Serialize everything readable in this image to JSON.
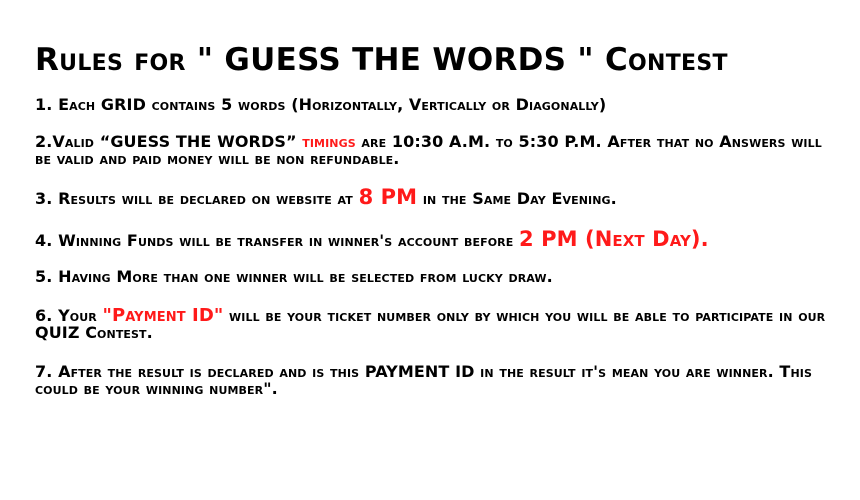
{
  "title": "Rules for \" GUESS THE WORDS \" Contest",
  "accent_color": "#ff1a1a",
  "rules": [
    {
      "text": "1. Each GRID contains 5 words (Horizontally, Vertically or Diagonally)"
    },
    {
      "before": "2.Valid “GUESS THE WORDS” ",
      "highlight": "timings",
      "after": " are 10:30 A.M. to 5:30 P.M. After that no Answers will be valid and paid money will be non refundable."
    },
    {
      "before": "3. Results will be declared on website at ",
      "highlight": "8 PM",
      "after": " in the Same Day Evening."
    },
    {
      "before": "4. Winning Funds will be transfer in winner's account before ",
      "highlight": "2 PM (Next Day).",
      "after": ""
    },
    {
      "text": "5. Having More than one winner will be selected from lucky draw."
    },
    {
      "before": "6. Your ",
      "highlight": "\"Payment ID\"",
      "after": " will be your ticket number only by which you will be able to participate in our QUIZ Contest."
    },
    {
      "text": "7. After the result is declared and is this PAYMENT ID in the result it's mean you are winner. This could be your winning number\"."
    }
  ]
}
